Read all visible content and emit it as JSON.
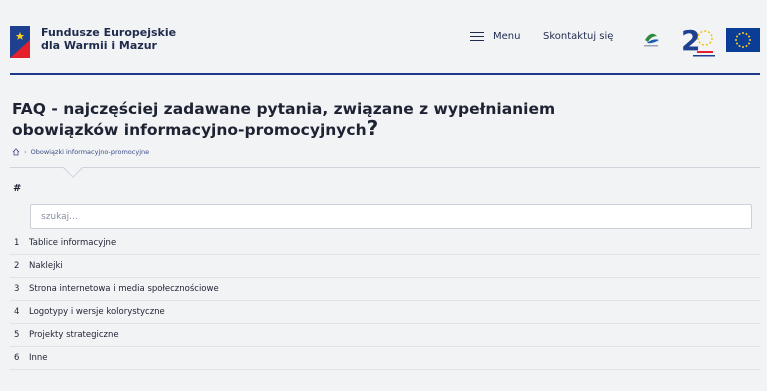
{
  "header": {
    "brand_line1": "Fundusze Europejskie",
    "brand_line2": "dla Warmii i Mazur",
    "menu_label": "Menu",
    "contact_label": "Skontaktuj się",
    "partner1_icon": "regional-logo-icon",
    "partner2_icon": "anniversary-20-logo-icon",
    "eu_icon": "eu-flag-icon",
    "accent_color": "#1d3a8a"
  },
  "page": {
    "title": "FAQ - najczęściej zadawane pytania, związane z wypełnianiem obowiązków informacyjno-promocyjnych",
    "title_mark": "?",
    "breadcrumb_home_icon": "home-icon",
    "breadcrumb_current": "Obowiązki informacyjno-promocyjne"
  },
  "faq": {
    "column_header": "#",
    "search_placeholder": "szukaj...",
    "items": [
      {
        "num": "1",
        "label": "Tablice informacyjne"
      },
      {
        "num": "2",
        "label": "Naklejki"
      },
      {
        "num": "3",
        "label": "Strona internetowa i media społecznościowe"
      },
      {
        "num": "4",
        "label": "Logotypy i wersje kolorystyczne"
      },
      {
        "num": "5",
        "label": "Projekty strategiczne"
      },
      {
        "num": "6",
        "label": "Inne"
      }
    ]
  }
}
